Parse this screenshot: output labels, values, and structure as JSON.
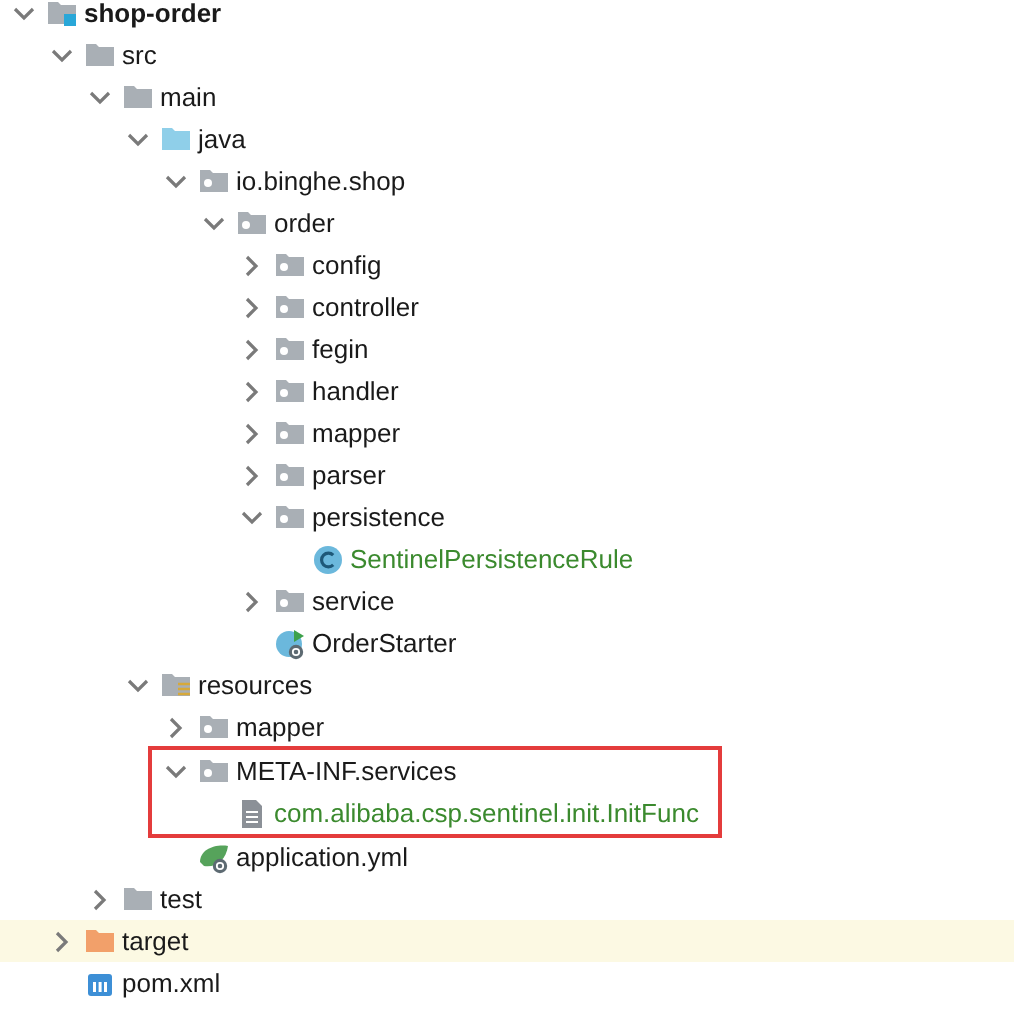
{
  "project_tree": {
    "items": [
      {
        "label": "shop-order",
        "kind": "module",
        "expanded": true,
        "children": [
          {
            "label": "src",
            "kind": "folder",
            "expanded": true,
            "children": [
              {
                "label": "main",
                "kind": "folder",
                "expanded": true,
                "children": [
                  {
                    "label": "java",
                    "kind": "source-folder",
                    "expanded": true,
                    "children": [
                      {
                        "label": "io.binghe.shop",
                        "kind": "package",
                        "expanded": true,
                        "children": [
                          {
                            "label": "order",
                            "kind": "package",
                            "expanded": true,
                            "children": [
                              {
                                "label": "config",
                                "kind": "package",
                                "expanded": false
                              },
                              {
                                "label": "controller",
                                "kind": "package",
                                "expanded": false
                              },
                              {
                                "label": "fegin",
                                "kind": "package",
                                "expanded": false
                              },
                              {
                                "label": "handler",
                                "kind": "package",
                                "expanded": false
                              },
                              {
                                "label": "mapper",
                                "kind": "package",
                                "expanded": false
                              },
                              {
                                "label": "parser",
                                "kind": "package",
                                "expanded": false
                              },
                              {
                                "label": "persistence",
                                "kind": "package",
                                "expanded": true,
                                "children": [
                                  {
                                    "label": "SentinelPersistenceRule",
                                    "kind": "class",
                                    "added": true
                                  }
                                ]
                              },
                              {
                                "label": "service",
                                "kind": "package",
                                "expanded": false
                              },
                              {
                                "label": "OrderStarter",
                                "kind": "spring-class",
                                "added": false
                              }
                            ]
                          }
                        ]
                      }
                    ]
                  },
                  {
                    "label": "resources",
                    "kind": "resources-folder",
                    "expanded": true,
                    "children": [
                      {
                        "label": "mapper",
                        "kind": "package",
                        "expanded": false
                      },
                      {
                        "label": "META-INF.services",
                        "kind": "package",
                        "expanded": true,
                        "framed": true,
                        "children": [
                          {
                            "label": "com.alibaba.csp.sentinel.init.InitFunc",
                            "kind": "file",
                            "added": true
                          }
                        ]
                      },
                      {
                        "label": "application.yml",
                        "kind": "yml",
                        "added": false
                      }
                    ]
                  }
                ]
              },
              {
                "label": "test",
                "kind": "folder",
                "expanded": false
              }
            ]
          },
          {
            "label": "target",
            "kind": "excluded-folder",
            "expanded": false,
            "highlighted": true
          },
          {
            "label": "pom.xml",
            "kind": "maven",
            "added": false
          }
        ]
      }
    ]
  }
}
